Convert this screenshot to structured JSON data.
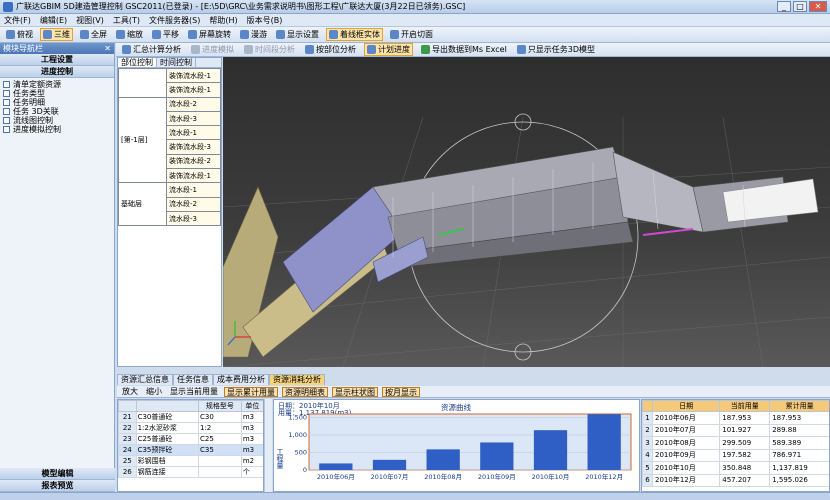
{
  "window": {
    "title": "广联达GBIM 5D建造管理控制 GSC2011(已登录) - [E:\\5D\\GRC\\业务需求说明书\\图形工程\\广联达大厦(3月22日已领务).GSC]"
  },
  "menu": [
    "文件(F)",
    "编辑(E)",
    "视图(V)",
    "工具(T)",
    "文件服务器(S)",
    "帮助(H)",
    "版本号(B)"
  ],
  "toolbar1": [
    "俯视",
    "三维",
    "全屏",
    "缩放",
    "平移",
    "屏幕旋转",
    "漫游",
    "显示设置",
    "着线框实体",
    "开启切面"
  ],
  "toolbar2": [
    "汇总计算分析",
    "进度模拟",
    "时间段分析",
    "按部位分析",
    "计划进度",
    "导出数据到Ms Excel",
    "只显示任务3D模型"
  ],
  "left_panel": {
    "header": "模块导航栏",
    "sections": [
      "工程设置",
      "进度控制"
    ],
    "tree": [
      "清单定额资源",
      "任务类型",
      "任务明细",
      "任务 3D关联",
      "流线图控制",
      "进度模拟控制"
    ],
    "bottom_sections": [
      "模型编辑",
      "报表预览"
    ]
  },
  "side_table": {
    "tabs": [
      "部位控制",
      "时间控制"
    ],
    "groups": [
      {
        "label": "",
        "rows": [
          "装饰流水段-1",
          "装饰流水段-1"
        ]
      },
      {
        "label": "[第-1层]",
        "rows": [
          "流水段-2",
          "流水段-3",
          "流水段-1",
          "装饰流水段-3",
          "装饰流水段-2",
          "装饰流水段-1"
        ]
      },
      {
        "label": "基础层",
        "rows": [
          "流水段-1",
          "流水段-2",
          "流水段-3"
        ]
      }
    ]
  },
  "bottom_tabs": [
    "资源汇总信息",
    "任务信息",
    "成本费用分析",
    "资源消耗分析"
  ],
  "bottom_toolbar": [
    "放大",
    "缩小",
    "显示当前用量",
    "显示累计用量",
    "资源明细表",
    "显示柱状图",
    "按月显示"
  ],
  "resource_table": {
    "headers": [
      "",
      "规格型号",
      "单位"
    ],
    "rows": [
      {
        "no": "21",
        "name": "C30普通砼",
        "spec": "C30",
        "unit": "m3"
      },
      {
        "no": "22",
        "name": "1:2水泥砂浆",
        "spec": "1:2",
        "unit": "m3"
      },
      {
        "no": "23",
        "name": "C25普通砼",
        "spec": "C25",
        "unit": "m3"
      },
      {
        "no": "24",
        "name": "C35预拌砼",
        "spec": "C35",
        "unit": "m3"
      },
      {
        "no": "25",
        "name": "彩钢围档",
        "spec": "",
        "unit": "m2"
      },
      {
        "no": "26",
        "name": "钢筋连接",
        "spec": "",
        "unit": "个"
      }
    ]
  },
  "chart_info": {
    "date_line": "日期：2010年10月",
    "usage_line": "用量：1,137.819(m3)"
  },
  "chart_data": {
    "type": "bar",
    "title": "资源曲线",
    "ylabel": "工程量",
    "categories": [
      "2010年06月",
      "2010年07月",
      "2010年08月",
      "2010年09月",
      "2010年10月",
      "2010年12月"
    ],
    "values": [
      187.953,
      101.927,
      299.509,
      197.582,
      350.848,
      457.207
    ],
    "cumulative": [
      187.953,
      289.88,
      589.389,
      786.971,
      1137.819,
      1595.026
    ],
    "plotted": "cumulative",
    "ylim": [
      0,
      1600
    ],
    "yticks": [
      0,
      500,
      1000,
      1500
    ],
    "ytick_labels": [
      "0",
      "500",
      "1,000",
      "1,500"
    ],
    "colors": {
      "bar": "#2f5fc4",
      "frame": "#cc6a2a",
      "plot_bg": "#dbe6f6"
    }
  },
  "data_table": {
    "headers": [
      "",
      "日期",
      "当前用量",
      "累计用量"
    ],
    "rows": [
      [
        "1",
        "2010年06月",
        "187.953",
        "187.953"
      ],
      [
        "2",
        "2010年07月",
        "101.927",
        "289.88"
      ],
      [
        "3",
        "2010年08月",
        "299.509",
        "589.389"
      ],
      [
        "4",
        "2010年09月",
        "197.582",
        "786.971"
      ],
      [
        "5",
        "2010年10月",
        "350.848",
        "1,137.819"
      ],
      [
        "6",
        "2010年12月",
        "457.207",
        "1,595.026"
      ]
    ]
  }
}
